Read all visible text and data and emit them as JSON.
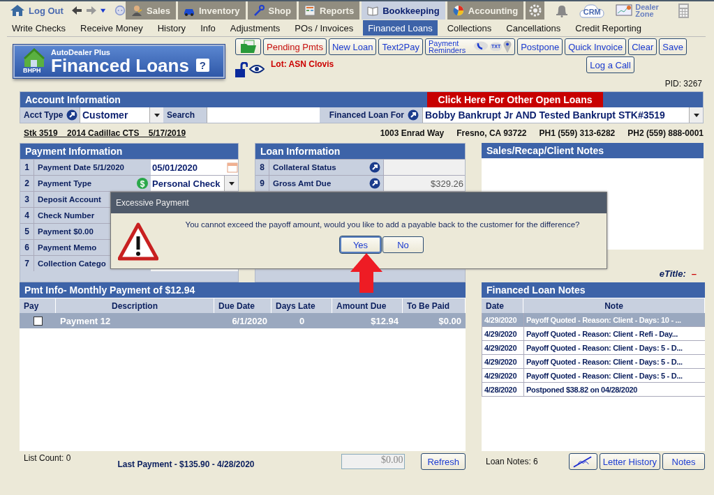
{
  "top_nav": {
    "logout": "Log Out",
    "modules": [
      {
        "label": "Sales",
        "selected": false
      },
      {
        "label": "Inventory",
        "selected": false
      },
      {
        "label": "Shop",
        "selected": false
      },
      {
        "label": "Reports",
        "selected": false
      },
      {
        "label": "Bookkeeping",
        "selected": true
      },
      {
        "label": "Accounting",
        "selected": false
      }
    ],
    "crm": "CRM",
    "dealer_zone": "Dealer Zone"
  },
  "sub_nav": [
    {
      "label": "Write Checks",
      "selected": false
    },
    {
      "label": "Receive Money",
      "selected": false
    },
    {
      "label": "History",
      "selected": false
    },
    {
      "label": "Info",
      "selected": false
    },
    {
      "label": "Adjustments",
      "selected": false
    },
    {
      "label": "POs / Invoices",
      "selected": false
    },
    {
      "label": "Financed Loans",
      "selected": true
    },
    {
      "label": "Collections",
      "selected": false
    },
    {
      "label": "Cancellations",
      "selected": false
    },
    {
      "label": "Credit Reporting",
      "selected": false
    }
  ],
  "banner": {
    "subtitle": "AutoDealer Plus",
    "title": "Financed Loans",
    "help": "?",
    "logo_text": "BHPH"
  },
  "toolbar": [
    {
      "kind": "icon"
    },
    {
      "kind": "alert",
      "label": "Pending Pmts"
    },
    {
      "kind": "text",
      "label": "New Loan"
    },
    {
      "kind": "text",
      "label": "Text2Pay"
    },
    {
      "kind": "reminders",
      "label": "Payment Reminders",
      "badge": "TXT"
    },
    {
      "kind": "text",
      "label": "Postpone"
    },
    {
      "kind": "text",
      "label": "Quick Invoice"
    },
    {
      "kind": "text",
      "label": "Clear"
    },
    {
      "kind": "text",
      "label": "Save"
    }
  ],
  "lot": "Lot: ASN Clovis",
  "log_call": "Log a Call",
  "pid": "PID: 3267",
  "account": {
    "title": "Account Information",
    "other_loans": "Click Here For Other Open Loans",
    "acct_type_label": "Acct Type",
    "acct_type": "Customer",
    "search_label": "Search",
    "loan_for_label": "Financed Loan For",
    "loan_for": "Bobby Bankrupt Jr AND Tested Bankrupt STK#3519"
  },
  "vehicle_link": "Stk 3519    2014 Cadillac CTS    5/17/2019",
  "address": [
    "1003 Enrad Way",
    "Fresno, CA 93722",
    "PH1 (559) 313-6282",
    "PH2 (559) 888-0001"
  ],
  "payment_info": {
    "title": "Payment Information",
    "rows": [
      {
        "num": "1",
        "label": "Payment Date  5/1/2020",
        "kind": "date",
        "value": "05/01/2020"
      },
      {
        "num": "2",
        "label": "Payment Type",
        "kind": "select",
        "value": "Personal Check",
        "badge": "$"
      },
      {
        "num": "3",
        "label": "Deposit Account",
        "kind": "text"
      },
      {
        "num": "4",
        "label": "Check Number",
        "kind": "text"
      },
      {
        "num": "5",
        "label": "Payment  $0.00",
        "kind": "text"
      },
      {
        "num": "6",
        "label": "Payment Memo",
        "kind": "text"
      },
      {
        "num": "7",
        "label": "Collection Catego",
        "kind": "text"
      }
    ]
  },
  "loan_info": {
    "title": "Loan Information",
    "rows": [
      {
        "num": "8",
        "label": "Collateral Status",
        "value": ""
      },
      {
        "num": "9",
        "label": "Gross Amt Due",
        "value": "$329.26"
      }
    ]
  },
  "client_notes": {
    "title": "Sales/Recap/Client Notes"
  },
  "etitle": {
    "label": "eTitle:",
    "value": "–"
  },
  "pmt_info": {
    "title": "Pmt Info- Monthly Payment of $12.94",
    "columns": [
      "Pay",
      "Description",
      "Due Date",
      "Days Late",
      "Amount Due",
      "To Be Paid"
    ],
    "rows": [
      {
        "checked": false,
        "selected": true,
        "description": "Payment 12",
        "due_date": "6/1/2020",
        "days_late": "0",
        "amount_due": "$12.94",
        "to_be_paid": "$0.00"
      }
    ],
    "list_count": "List Count:  0",
    "last_payment": "Last Payment - $135.90 - 4/28/2020",
    "total": "$0.00",
    "refresh": "Refresh"
  },
  "loan_notes": {
    "title": "Financed Loan Notes",
    "columns": [
      "Date",
      "Note"
    ],
    "rows": [
      {
        "date": "4/29/2020",
        "note": "Payoff Quoted - Reason: Client - Days: 10 - ...",
        "selected": true
      },
      {
        "date": "4/29/2020",
        "note": "Payoff Quoted - Reason: Client - Refi - Day...",
        "selected": false
      },
      {
        "date": "4/29/2020",
        "note": "Payoff Quoted - Reason: Client - Days: 5 - D...",
        "selected": false
      },
      {
        "date": "4/29/2020",
        "note": "Payoff Quoted - Reason: Client - Days: 5 - D...",
        "selected": false
      },
      {
        "date": "4/29/2020",
        "note": "Payoff Quoted - Reason: Client - Days: 5 - D...",
        "selected": false
      },
      {
        "date": "4/28/2020",
        "note": "Postponed $38.82 on 04/28/2020",
        "selected": false
      }
    ],
    "count": "Loan Notes:  6",
    "letter_history": "Letter History",
    "notes": "Notes"
  },
  "dialog": {
    "title": "Excessive Payment",
    "message": "You cannot exceed the payoff amount, would you like to add a payable back to the customer for the difference?",
    "buttons": [
      {
        "label": "Yes",
        "selected": true
      },
      {
        "label": "No",
        "selected": false
      }
    ]
  }
}
